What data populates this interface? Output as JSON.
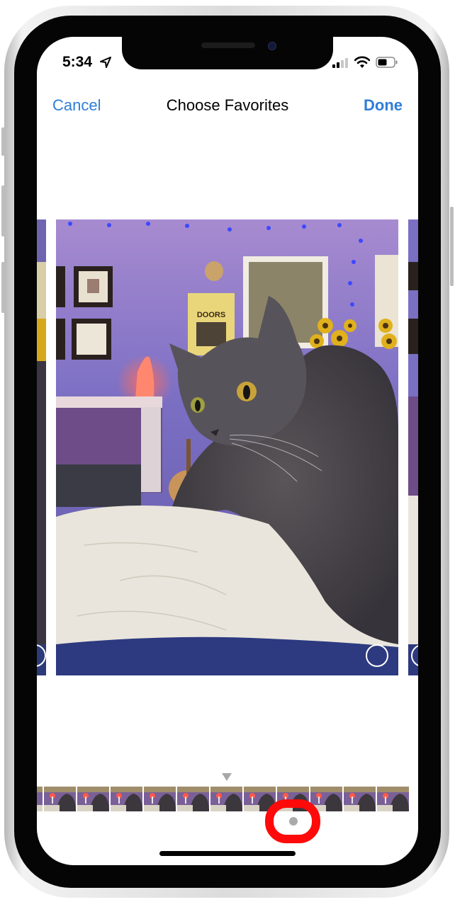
{
  "status_bar": {
    "time": "5:34",
    "location_icon": "location-arrow-icon",
    "signal_icon": "cellular-signal-icon",
    "wifi_icon": "wifi-icon",
    "battery_icon": "battery-icon"
  },
  "nav": {
    "cancel_label": "Cancel",
    "title": "Choose Favorites",
    "done_label": "Done"
  },
  "photos": {
    "main": {
      "description": "Gray long-haired cat sitting on a white pillow in a purple bedroom",
      "poster_text": "DOORS",
      "selected": false
    },
    "previous_partial": {
      "selected": false
    },
    "next_partial": {
      "selected": false
    }
  },
  "filmstrip": {
    "thumbnail_count": 12,
    "scrubber_icon": "triangle-down-icon"
  },
  "page_indicator": {
    "dot_icon": "page-dot-icon",
    "annotation": "red-highlight-circle"
  },
  "colors": {
    "accent": "#2f7ed8",
    "highlight": "#ff0a0a",
    "wall": "#7a6fc2"
  }
}
